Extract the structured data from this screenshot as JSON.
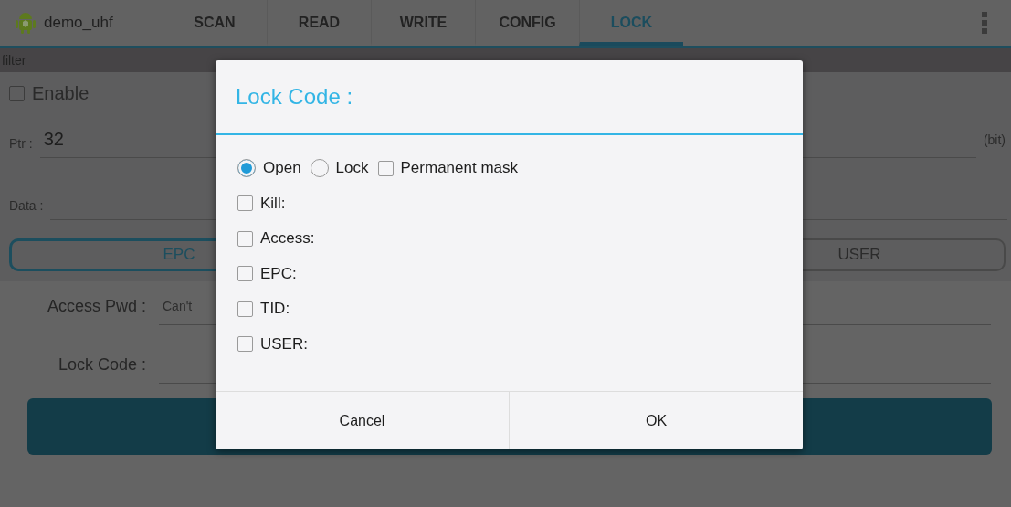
{
  "app": {
    "title": "demo_uhf"
  },
  "tabs": [
    {
      "label": "SCAN",
      "selected": false
    },
    {
      "label": "READ",
      "selected": false
    },
    {
      "label": "WRITE",
      "selected": false
    },
    {
      "label": "CONFIG",
      "selected": false
    },
    {
      "label": "LOCK",
      "selected": true
    }
  ],
  "filter": {
    "title": "filter",
    "enable": {
      "label": "Enable",
      "checked": false
    },
    "ptr": {
      "label": "Ptr :",
      "value": "32",
      "unit": "(bit)"
    },
    "data": {
      "label": "Data :"
    },
    "banks": [
      {
        "label": "EPC",
        "selected": true
      },
      {
        "label": "USER",
        "selected": false
      }
    ]
  },
  "access_pwd": {
    "label": "Access Pwd :",
    "placeholder": "Can't"
  },
  "lock_code": {
    "label": "Lock Code :"
  },
  "dialog": {
    "title": "Lock Code :",
    "modes": [
      {
        "label": "Open",
        "selected": true
      },
      {
        "label": "Lock",
        "selected": false
      }
    ],
    "permanent_mask": {
      "label": "Permanent mask",
      "checked": false
    },
    "areas": [
      {
        "label": "Kill:",
        "checked": false
      },
      {
        "label": "Access:",
        "checked": false
      },
      {
        "label": "EPC:",
        "checked": false
      },
      {
        "label": "TID:",
        "checked": false
      },
      {
        "label": "USER:",
        "checked": false
      }
    ],
    "buttons": [
      "Cancel",
      "OK"
    ]
  }
}
